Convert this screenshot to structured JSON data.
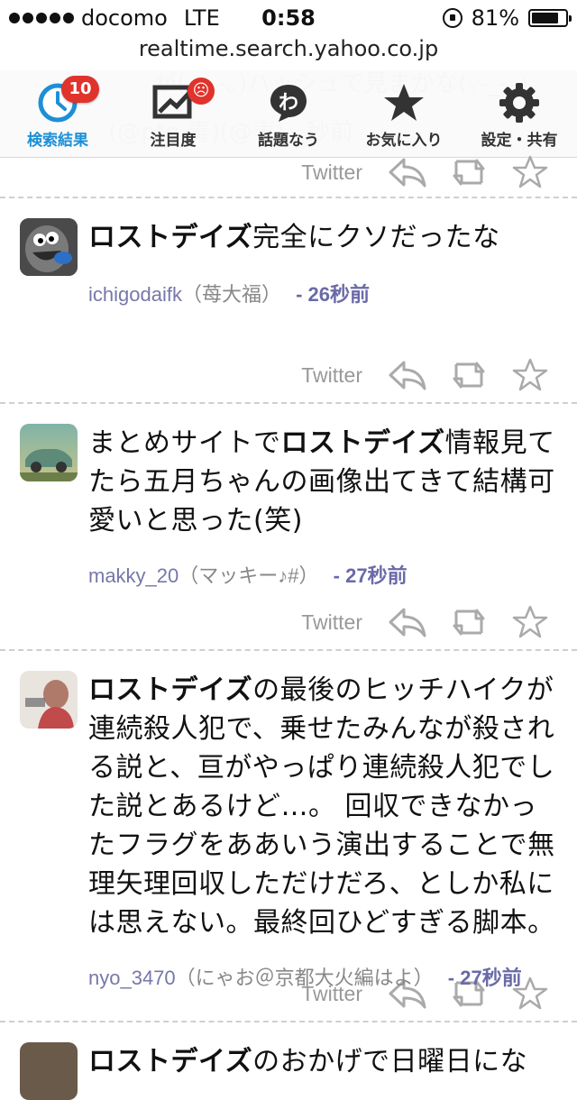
{
  "status": {
    "carrier": "docomo",
    "network": "LTE",
    "time": "0:58",
    "battery": "81%",
    "battery_level": 0.81
  },
  "url": "realtime.search.yahoo.co.jp",
  "ghost_text": {
    "line1": "が(｡-_-｡)ハッシュで見まかな(｡-_-｡)",
    "line2": "(@ptg 毒)(@表)",
    "line3": "秒前"
  },
  "tabs": [
    {
      "label": "検索結果",
      "icon": "clock-icon",
      "badge": "10",
      "active": true
    },
    {
      "label": "注目度",
      "icon": "trend-chart-icon",
      "badge": "☹"
    },
    {
      "label": "話題なう",
      "icon": "wa-bubble-icon"
    },
    {
      "label": "お気に入り",
      "icon": "star-icon"
    },
    {
      "label": "設定・共有",
      "icon": "gear-icon"
    }
  ],
  "source_label": "Twitter",
  "posts": [
    {
      "text_keyword": "ロストデイズ",
      "text_rest": "完全にクソだったな",
      "text_pre": "",
      "screen_name": "ichigodaifk",
      "display_name": "（苺大福）",
      "ago": "26秒前",
      "avatar": "cartoon-face-avatar"
    },
    {
      "text_pre": "まとめサイトで",
      "text_keyword": "ロストデイズ",
      "text_rest": "情報見てたら五月ちゃんの画像出てきて結構可愛いと思った(笑)",
      "screen_name": "makky_20",
      "display_name": "（マッキー♪#）",
      "ago": "27秒前",
      "avatar": "car-photo-avatar"
    },
    {
      "text_pre": "",
      "text_keyword": "ロストデイズ",
      "text_rest": "の最後のヒッチハイクが連続殺人犯で、乗せたみんなが殺される説と、亘がやっぱり連続殺人犯でした説とあるけど…。 回収できなかったフラグをああいう演出することで無理矢理回収しただけだろ、としか私には思えない。最終回ひどすぎる脚本。",
      "screen_name": "nyo_3470",
      "display_name": "（にゃお＠京都大火編はよ）",
      "ago": "27秒前",
      "avatar": "girl-photo-avatar"
    }
  ],
  "next_post_partial": {
    "text_keyword": "ロストデイズ",
    "text_rest": "のおかげで日曜日にな"
  }
}
